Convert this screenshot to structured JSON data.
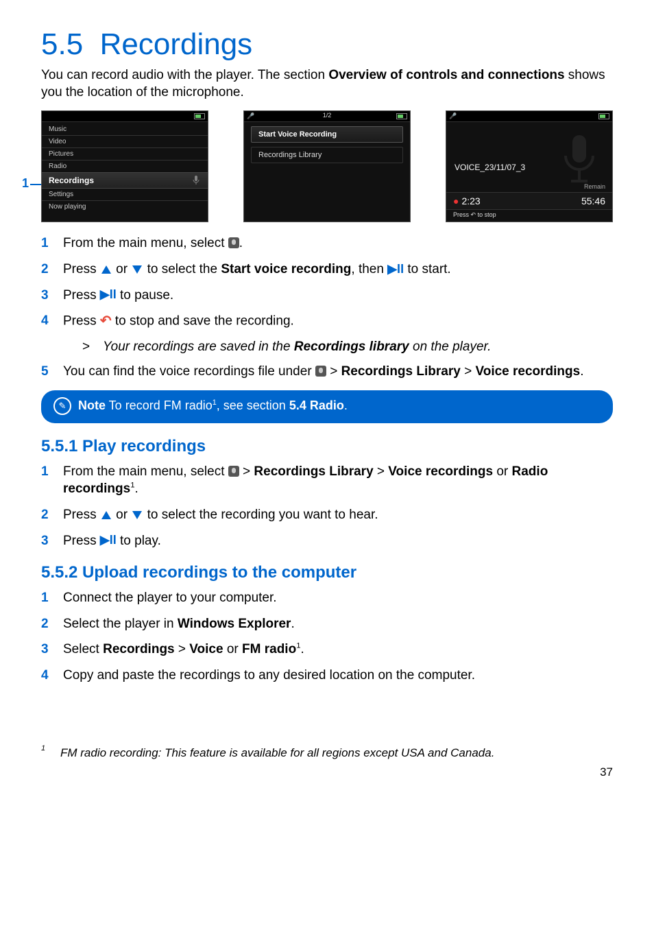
{
  "section": {
    "number": "5.5",
    "title": "Recordings",
    "intro_pre": "You can record audio with the player. The section ",
    "intro_bold": "Overview of controls and connections",
    "intro_post": " shows you the location of the microphone."
  },
  "screens": {
    "pointer": "1",
    "menu1": {
      "items": [
        "Music",
        "Video",
        "Pictures",
        "Radio"
      ],
      "selected": "Recordings",
      "tail": [
        "Settings",
        "Now playing"
      ]
    },
    "menu2": {
      "counter": "1/2",
      "opt1": "Start Voice Recording",
      "opt2": "Recordings Library"
    },
    "rec": {
      "filename": "VOICE_23/11/07_3",
      "elapsed": "2:23",
      "remain_label": "Remain",
      "remain": "55:46",
      "press": "Press",
      "press2": "to stop"
    }
  },
  "steps_a": {
    "s1": "From the main menu, select ",
    "s1b": ".",
    "s2a": "Press ",
    "s2b": " or ",
    "s2c": " to select the ",
    "s2d": "Start voice recording",
    "s2e": ", then ",
    "s2f": " to start.",
    "s3a": "Press ",
    "s3b": " to pause.",
    "s4a": "Press ",
    "s4b": " to stop and save the recording.",
    "s4r_pre": "Your recordings are saved in the ",
    "s4r_bold": "Recordings library",
    "s4r_post": " on the player.",
    "s5a": "You can find the voice recordings file under ",
    "s5b": " > ",
    "s5c": "Recordings Library",
    "s5d": " > ",
    "s5e": "Voice recordings",
    "s5f": "."
  },
  "note": {
    "label": "Note",
    "pre": " To record FM radio",
    "sup": "1",
    "mid": ", see section ",
    "bold": "5.4 Radio",
    "post": "."
  },
  "sub1": {
    "title": "5.5.1 Play recordings",
    "s1a": "From the main menu, select ",
    "s1b": " > ",
    "s1c": "Recordings Library",
    "s1d": " > ",
    "s1e": "Voice recordings",
    "s1f": " or ",
    "s1g": "Radio recordings",
    "s1h": ".",
    "sup": "1",
    "s2a": "Press ",
    "s2b": " or ",
    "s2c": " to select the recording you want to hear.",
    "s3a": "Press ",
    "s3b": " to play."
  },
  "sub2": {
    "title": "5.5.2 Upload recordings to the computer",
    "s1": "Connect the player to your computer.",
    "s2a": "Select the player in ",
    "s2b": "Windows Explorer",
    "s2c": ".",
    "s3a": "Select ",
    "s3b": "Recordings",
    "s3c": " > ",
    "s3d": "Voice",
    "s3e": " or ",
    "s3f": "FM radio",
    "s3g": ".",
    "sup": "1",
    "s4": "Copy and paste the recordings to any desired location on the computer."
  },
  "footnote": {
    "mark": "1",
    "text": "FM radio recording: This feature is available for all regions except USA and Canada."
  },
  "page": "37"
}
